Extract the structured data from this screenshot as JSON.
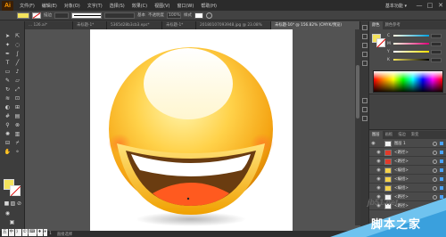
{
  "app": {
    "logo": "Ai",
    "workspace_label": "基本功能 ▾"
  },
  "menu": [
    "文件(F)",
    "编辑(E)",
    "对象(O)",
    "文字(T)",
    "选择(S)",
    "效果(C)",
    "视图(V)",
    "窗口(W)",
    "帮助(H)"
  ],
  "window_controls": {
    "minimize": "—",
    "maximize": "□",
    "close": "✕"
  },
  "control_bar": {
    "stroke_label": "描边",
    "style_label": "基本",
    "opacity_label": "不透明度",
    "opacity_value": "100%",
    "style_field": "样式"
  },
  "tabs": [
    {
      "label": "... 126.ai*"
    },
    {
      "label": "未标题-1*"
    },
    {
      "label": "5365d28b3cb3.eps*"
    },
    {
      "label": "未标题-1*"
    },
    {
      "label": "20180107093948.jpg @ 23.08%"
    },
    {
      "label": "未标题-16* @ 156.82% (CMYK/预览)",
      "active": true
    }
  ],
  "color_panel": {
    "tabs": [
      "颜色",
      "颜色参考"
    ],
    "channels": [
      {
        "letter": "C",
        "value": "",
        "color": "#00a0e0"
      },
      {
        "letter": "M",
        "value": "",
        "color": "#e0007a"
      },
      {
        "letter": "Y",
        "value": "",
        "color": "#ffe000"
      },
      {
        "letter": "K",
        "value": "",
        "color": "#000000"
      }
    ],
    "fill_color": "#f4e35c"
  },
  "layers_panel": {
    "tabs": [
      "图层",
      "画板",
      "描边",
      "渐变"
    ],
    "rows": [
      {
        "name": "图层 1",
        "expanded": true
      },
      {
        "name": "<路径>"
      },
      {
        "name": "<路径>"
      },
      {
        "name": "<编组>"
      },
      {
        "name": "<编组>"
      },
      {
        "name": "<编组>"
      },
      {
        "name": "<路径>"
      },
      {
        "name": "<路径>"
      }
    ]
  },
  "status": {
    "zoom": "156.82%",
    "page": "1",
    "mode": "直接选择"
  },
  "ime": [
    "五",
    "中",
    "》",
    "©",
    "⌨",
    "♦",
    "▾"
  ],
  "watermark": {
    "url": "jb51.net",
    "text": "脚本之家"
  },
  "colors": {
    "fill": "#f4e35c",
    "ai_orange": "#ff9a00",
    "canvas": "#535353",
    "artboard": "#ffffff"
  }
}
